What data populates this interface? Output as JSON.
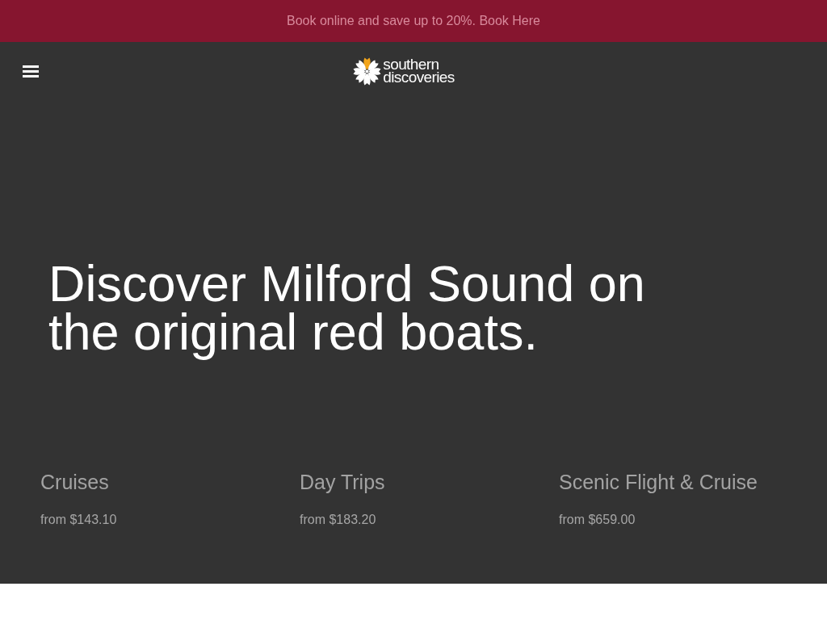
{
  "promo_banner": {
    "text": "Book online and save up to 20%.",
    "link": "Book Here"
  },
  "header": {
    "logo": {
      "line_1": "southern",
      "line_2": "discoveries"
    }
  },
  "hero": {
    "heading": "Discover Milford Sound on the original red boats."
  },
  "categories": [
    {
      "title": "Cruises",
      "price": "from $143.10"
    },
    {
      "title": "Day Trips",
      "price": "from $183.20"
    },
    {
      "title": "Scenic Flight & Cruise",
      "price": "from $659.00"
    }
  ]
}
